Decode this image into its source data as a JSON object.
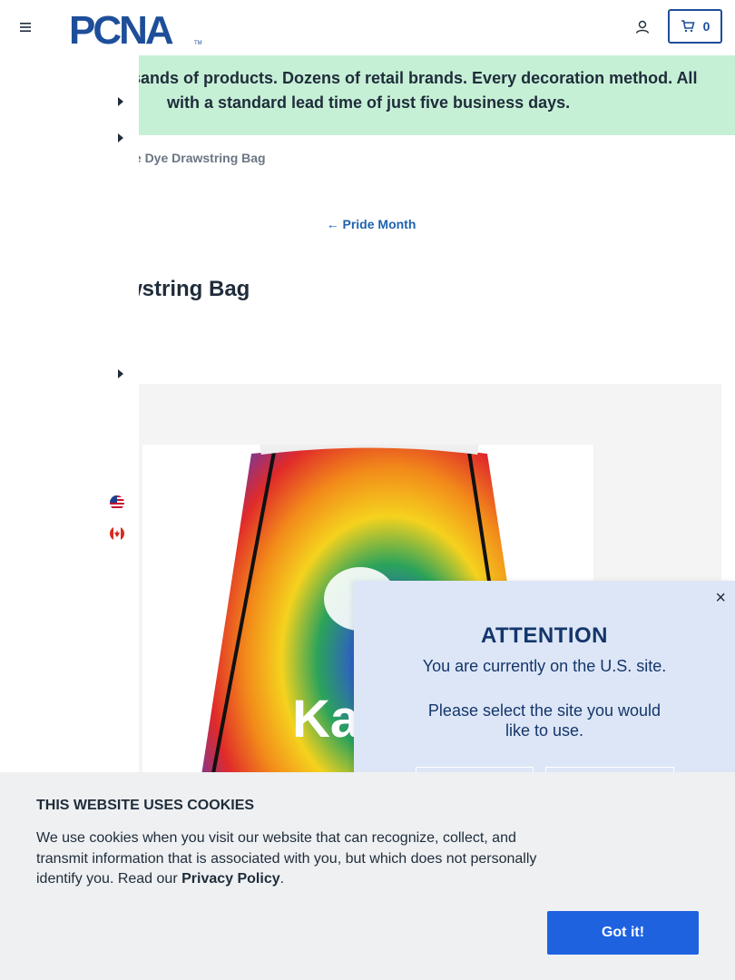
{
  "header": {
    "logo_text": "PCNA",
    "cart_count": "0"
  },
  "banner": {
    "line1": "usands of products. Dozens of retail brands. Every decoration method. All",
    "line2": "with a standard lead time of just five business days."
  },
  "breadcrumb": {
    "current": "ie Dye Drawstring Bag"
  },
  "back_link": {
    "label": "Pride Month"
  },
  "product": {
    "title": "wstring Bag",
    "image_text": "Ka"
  },
  "modal": {
    "heading": "ATTENTION",
    "line1": "You are currently on the U.S. site.",
    "line2": "Please select the site you would like to use.",
    "close": "×"
  },
  "cookie": {
    "heading": "THIS WEBSITE USES COOKIES",
    "body": "We use cookies when you visit our website that can recognize, collect, and transmit information that is associated with you, but which does not personally identify you. Read our ",
    "link": "Privacy Policy",
    "period": ".",
    "button": "Got it!"
  },
  "colors": {
    "brand_blue": "#1e62b0",
    "banner_green": "#c6f0d6",
    "modal_bg": "#dde6f6",
    "button_blue": "#1e62e0"
  }
}
